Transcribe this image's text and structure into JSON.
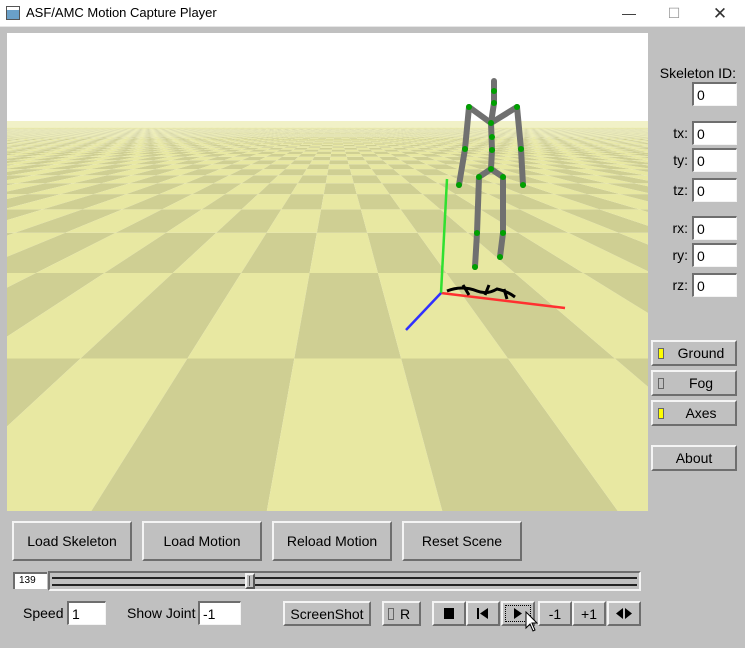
{
  "window": {
    "title": "ASF/AMC Motion Capture Player"
  },
  "right_panel": {
    "skeleton_id_label": "Skeleton ID:",
    "skeleton_id_value": "0",
    "tx_label": "tx:",
    "tx_value": "0",
    "ty_label": "ty:",
    "ty_value": "0",
    "tz_label": "tz:",
    "tz_value": "0",
    "rx_label": "rx:",
    "rx_value": "0",
    "ry_label": "ry:",
    "ry_value": "0",
    "rz_label": "rz:",
    "rz_value": "0",
    "ground_label": "Ground",
    "ground_on": true,
    "fog_label": "Fog",
    "fog_on": false,
    "axes_label": "Axes",
    "axes_on": true,
    "about_label": "About"
  },
  "bottom": {
    "load_skeleton": "Load Skeleton",
    "load_motion": "Load Motion",
    "reload_motion": "Reload Motion",
    "reset_scene": "Reset Scene",
    "frame": "139",
    "slider_fraction": 0.336,
    "speed_label": "Speed",
    "speed_value": "1",
    "show_joint_label": "Show Joint",
    "show_joint_value": "-1",
    "screenshot_label": "ScreenShot",
    "record_label": "R",
    "step_back_label": "-1",
    "step_fwd_label": "+1"
  },
  "colors": {
    "panel_bg": "#c0c0c0",
    "toggle_on": "#ffff00",
    "ground_light": "#e8e8a2",
    "ground_dark": "#cfcf93",
    "axis_x": "#ff3030",
    "axis_y": "#30e030",
    "axis_z": "#3030ff",
    "bone": "#707070",
    "joint": "#00a000"
  },
  "icons": {
    "window": "app-window-icon",
    "minimize": "minimize-icon",
    "maximize": "maximize-icon",
    "close": "close-icon",
    "stop": "stop-icon",
    "rewind": "skip-start-icon",
    "play": "play-icon",
    "repeat": "bidirectional-arrow-icon",
    "cursor": "mouse-cursor-icon"
  }
}
